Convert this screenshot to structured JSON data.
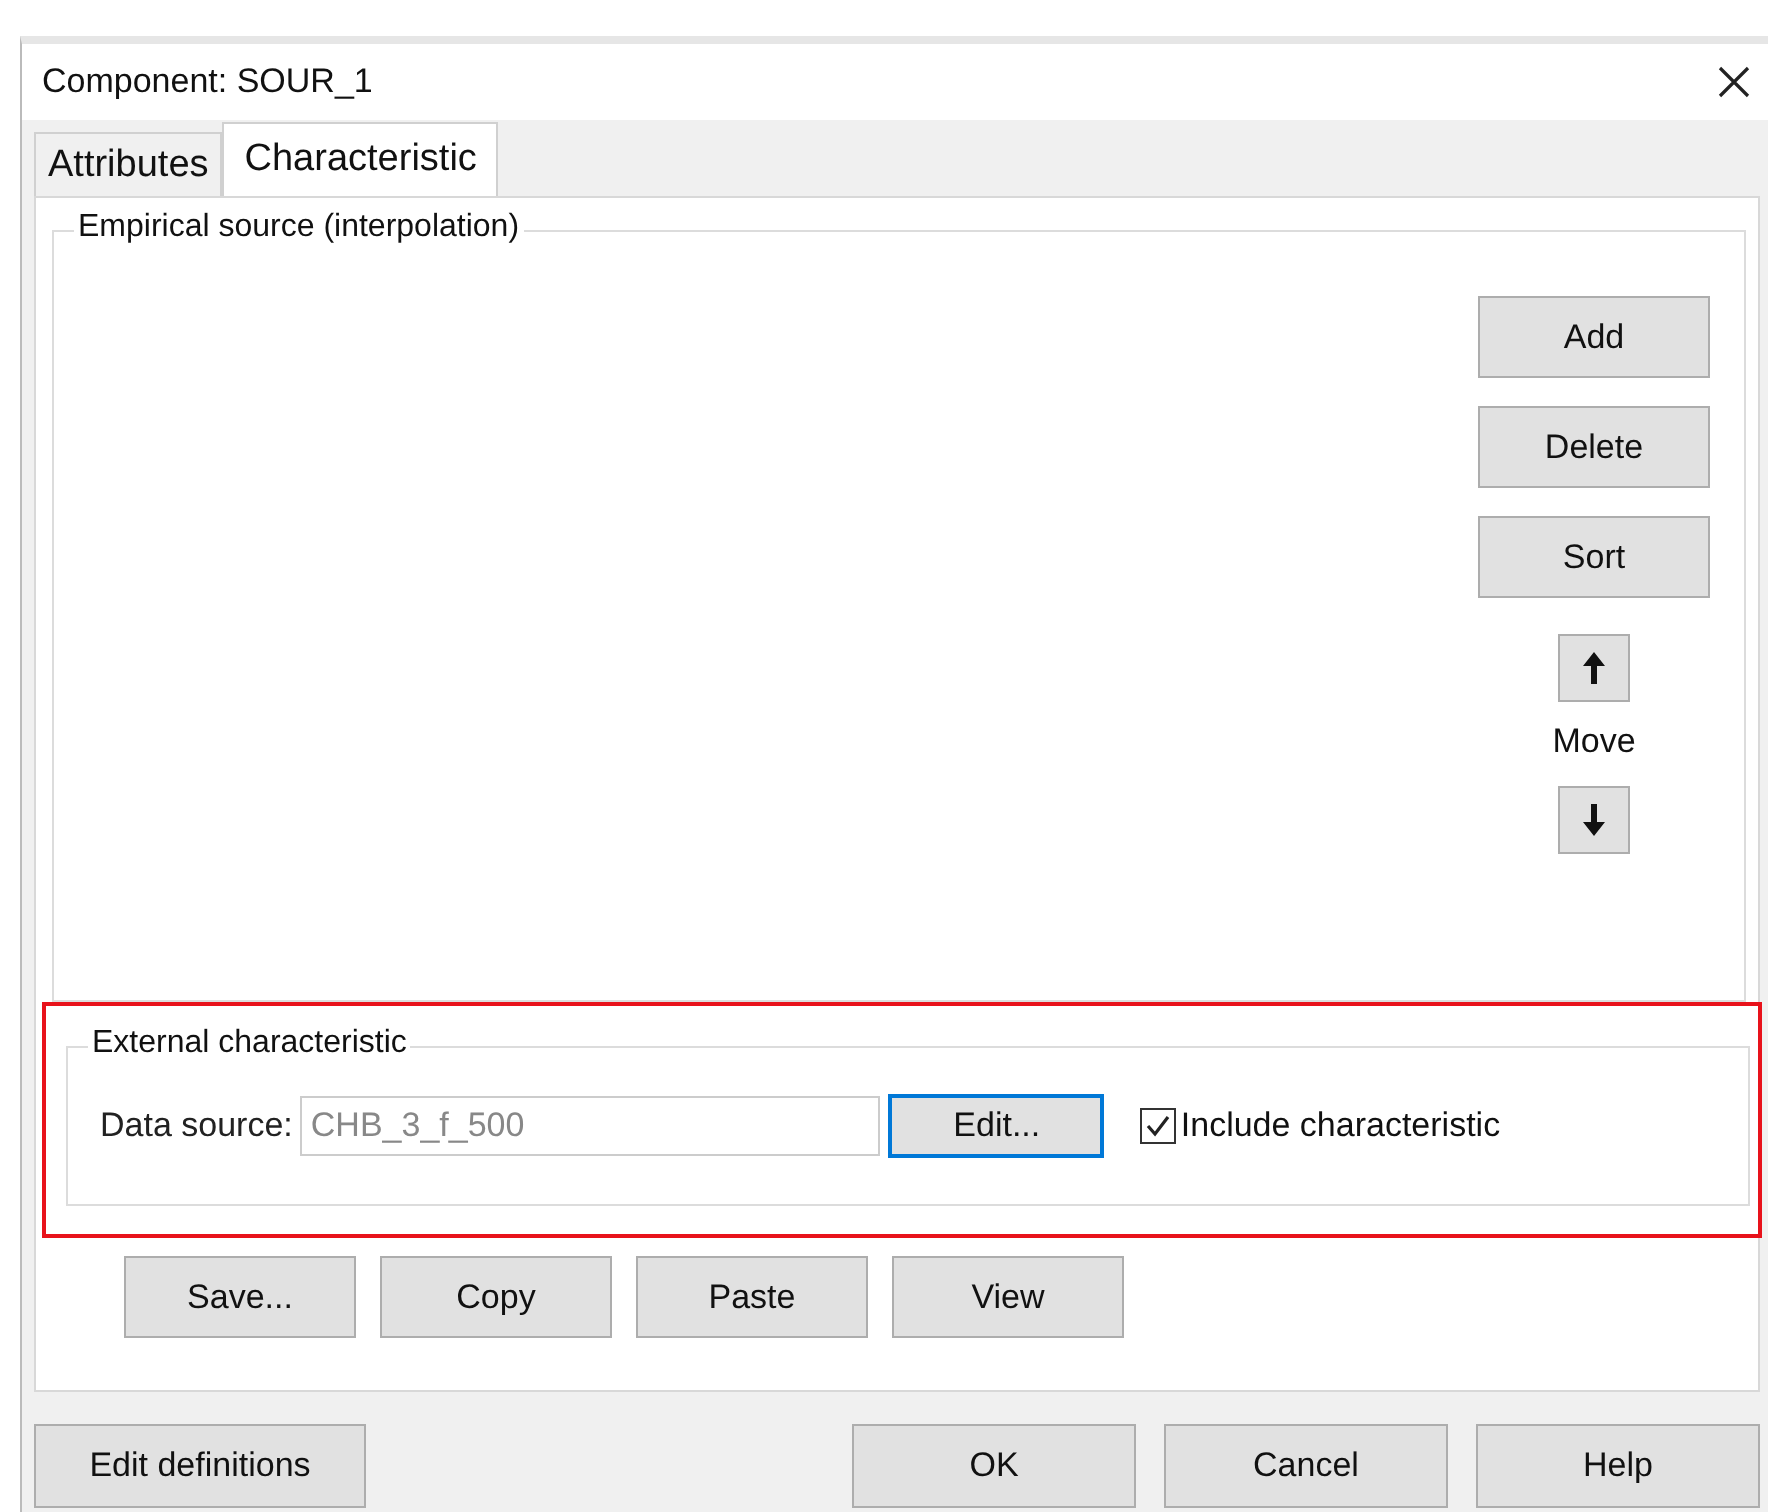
{
  "window": {
    "title": "Component: SOUR_1"
  },
  "tabs": [
    {
      "label": "Attributes",
      "selected": false
    },
    {
      "label": "Characteristic",
      "selected": true
    }
  ],
  "empirical": {
    "title": "Empirical source (interpolation)",
    "buttons": [
      "Add",
      "Delete",
      "Sort"
    ],
    "move_label": "Move"
  },
  "external": {
    "title": "External characteristic",
    "highlighted": true,
    "data_source_label": "Data source:",
    "data_source_value": "CHB_3_f_500",
    "edit_button": "Edit...",
    "include": {
      "label": "Include characteristic",
      "checked": true
    }
  },
  "actions": [
    "Save...",
    "Copy",
    "Paste",
    "View"
  ],
  "footer": {
    "left": "Edit definitions",
    "right": [
      "OK",
      "Cancel",
      "Help"
    ]
  }
}
